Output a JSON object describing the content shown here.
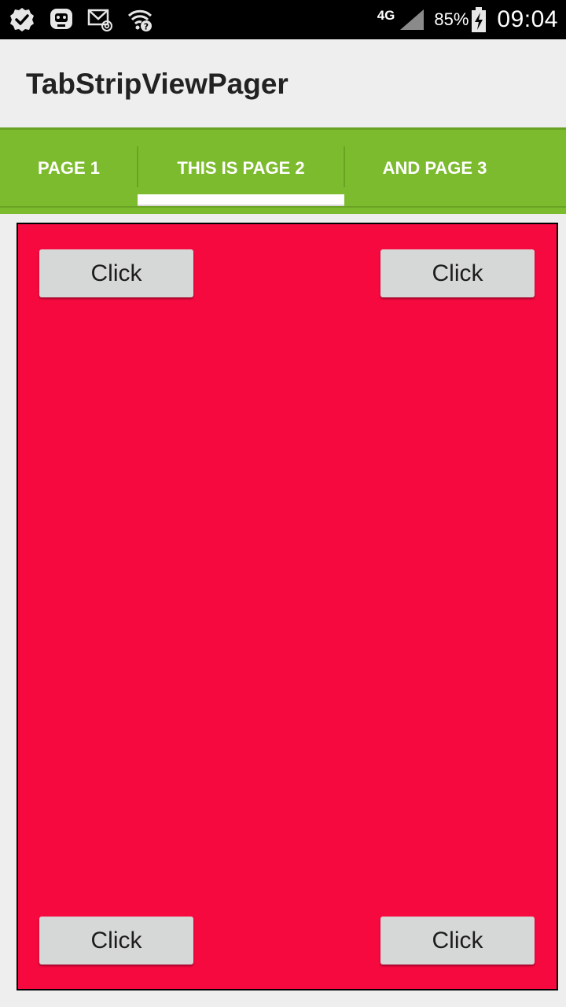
{
  "status_bar": {
    "icons_left": [
      "check-badge-icon",
      "chat-bot-icon",
      "mail-at-icon",
      "wifi-question-icon"
    ],
    "network_type": "4G",
    "battery_percent": "85%",
    "time": "09:04"
  },
  "app_bar": {
    "title": "TabStripViewPager"
  },
  "tabs": [
    {
      "label": "PAGE 1",
      "selected": false
    },
    {
      "label": "THIS IS PAGE 2",
      "selected": true
    },
    {
      "label": "AND PAGE 3",
      "selected": false
    }
  ],
  "page": {
    "buttons": [
      {
        "label": "Click"
      },
      {
        "label": "Click"
      },
      {
        "label": "Click"
      },
      {
        "label": "Click"
      }
    ]
  },
  "colors": {
    "tab_strip": "#7cbb2d",
    "page_background": "#f5093f",
    "button": "#d6d7d7"
  }
}
